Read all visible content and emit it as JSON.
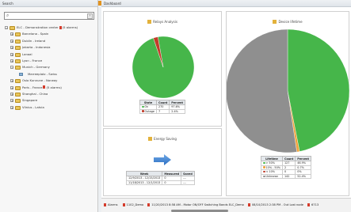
{
  "search_panel": {
    "title": "Search",
    "search_value": "",
    "tree": [
      {
        "label": "ELC - Demonstration center",
        "alarms": "(5 alarms)",
        "level": 0,
        "expanded": true
      },
      {
        "label": "Barcelona - Spain",
        "level": 1
      },
      {
        "label": "Dublin - Ireland",
        "level": 1
      },
      {
        "label": "Jakarta - Indonesia",
        "level": 1
      },
      {
        "label": "Lanaal",
        "level": 1
      },
      {
        "label": "Lyon - France",
        "level": 1
      },
      {
        "label": "Munich - Germany",
        "level": 1,
        "expanded": true
      },
      {
        "label": "Marreeplatz - Swiss",
        "level": 2
      },
      {
        "label": "Oslo Kunnune - Norway",
        "level": 1
      },
      {
        "label": "Paris - France",
        "alarms": "(5 alarms)",
        "level": 1
      },
      {
        "label": "Shanghai - China",
        "level": 1
      },
      {
        "label": "Singapore",
        "level": 1
      },
      {
        "label": "Vilnius - Latvia",
        "level": 1
      }
    ]
  },
  "dashboard": {
    "title": "Dashboard",
    "relays": {
      "title": "Relays Analysis",
      "headers": [
        "State",
        "Count",
        "Percent"
      ],
      "rows": [
        {
          "state": "On",
          "count": "270",
          "percent": "97.6%",
          "color": "#46b64a"
        },
        {
          "state": "Outage",
          "count": "7",
          "percent": "2.4%",
          "color": "#c23c2a"
        }
      ]
    },
    "energy": {
      "title": "Energy Saving",
      "headers": [
        "Week",
        "Measured",
        "Saved"
      ],
      "rows": [
        {
          "week": "12/9/2013 - 12/15/2013",
          "measured": "0",
          "saved": "---"
        },
        {
          "week": "11/18/2013 - 12/1/2013",
          "measured": "0",
          "saved": "---"
        }
      ]
    },
    "lifetime": {
      "title": "Device lifetime",
      "headers": [
        "Lifetime",
        "Count",
        "Percent"
      ],
      "rows": [
        {
          "lifetime": "> 50%",
          "count": "127",
          "percent": "46.9%",
          "color": "#46b64a"
        },
        {
          "lifetime": "10% - 50%",
          "count": "2",
          "percent": "0.7%",
          "color": "#f0a23a"
        },
        {
          "lifetime": "< 10%",
          "count": "0",
          "percent": "0%",
          "color": "#c23c2a"
        },
        {
          "lifetime": "Unknown",
          "count": "142",
          "percent": "52.4%",
          "color": "#8f8f8f"
        }
      ]
    }
  },
  "alarm_bar": {
    "label": "Alarms",
    "items": [
      "1102_Demo",
      "11/20/2013 8:58 AM - Motor ON/OFF Switching Bands ELC_Demo",
      "08/10/2013 2:38 PM - Out Lost node",
      "6713"
    ]
  },
  "chart_data": [
    {
      "type": "pie",
      "title": "Relays Analysis",
      "categories": [
        "On",
        "Outage"
      ],
      "values": [
        97.6,
        2.4
      ],
      "colors": [
        "#46b64a",
        "#c23c2a"
      ]
    },
    {
      "type": "pie",
      "title": "Device lifetime",
      "categories": [
        "> 50%",
        "10% - 50%",
        "< 10%",
        "Unknown"
      ],
      "values": [
        46.9,
        0.7,
        0,
        52.4
      ],
      "colors": [
        "#46b64a",
        "#f0a23a",
        "#c23c2a",
        "#8f8f8f"
      ]
    }
  ]
}
